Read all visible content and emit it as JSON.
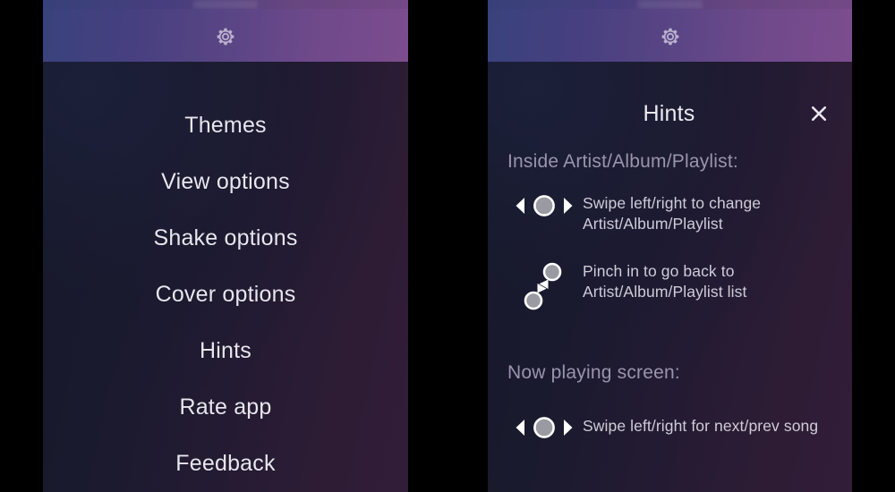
{
  "theme": {
    "header_gradient_start": "#39427c",
    "header_gradient_end": "#7c4c8e",
    "content_bg_start": "#151827",
    "content_bg_end": "#321d38",
    "menu_text_color": "#e7e6ee",
    "section_title_color": "#9a94ad",
    "hint_text_color": "#cfccd9",
    "gesture_icon_color": "#ffffff",
    "gesture_dot_fill": "#9a9aa2",
    "frame_color": "#000000"
  },
  "left_panel": {
    "header": {
      "icon": "gear-icon"
    },
    "menu": {
      "items": [
        {
          "label": "Themes"
        },
        {
          "label": "View options"
        },
        {
          "label": "Shake options"
        },
        {
          "label": "Cover options"
        },
        {
          "label": "Hints"
        },
        {
          "label": "Rate app"
        },
        {
          "label": "Feedback"
        }
      ]
    }
  },
  "right_panel": {
    "header": {
      "icon": "gear-icon"
    },
    "dialog": {
      "title": "Hints",
      "close_icon": "close-icon",
      "sections": [
        {
          "title": "Inside Artist/Album/Playlist:",
          "hints": [
            {
              "gesture": "swipe-horizontal-icon",
              "text": "Swipe left/right to change Artist/Album/Playlist"
            },
            {
              "gesture": "pinch-in-icon",
              "text": "Pinch in to go back to Artist/Album/Playlist list"
            }
          ]
        },
        {
          "title": "Now playing screen:",
          "hints": [
            {
              "gesture": "swipe-horizontal-icon",
              "text": "Swipe left/right for next/prev song"
            }
          ]
        }
      ]
    }
  }
}
